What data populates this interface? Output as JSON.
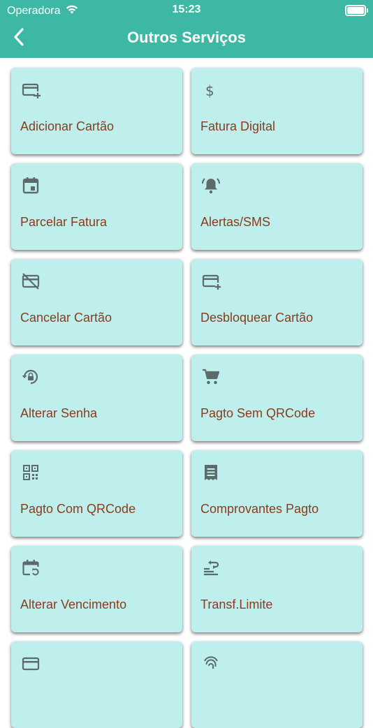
{
  "status_bar": {
    "carrier": "Operadora",
    "time": "15:23"
  },
  "nav": {
    "title": "Outros Serviços",
    "back_icon": "chevron-left-icon"
  },
  "colors": {
    "header": "#3cb8a5",
    "tile_background": "#bfefec",
    "tile_label": "#8a3b1c",
    "icon": "#5d6a6c"
  },
  "services": [
    {
      "label": "Adicionar Cartão",
      "icon": "card-plus-icon"
    },
    {
      "label": "Fatura Digital",
      "icon": "dollar-icon"
    },
    {
      "label": "Parcelar Fatura",
      "icon": "calendar-icon"
    },
    {
      "label": "Alertas/SMS",
      "icon": "bell-alert-icon"
    },
    {
      "label": "Cancelar Cartão",
      "icon": "card-off-icon"
    },
    {
      "label": "Desbloquear Cartão",
      "icon": "card-plus-icon"
    },
    {
      "label": "Alterar Senha",
      "icon": "lock-reset-icon"
    },
    {
      "label": "Pagto Sem QRCode",
      "icon": "cart-icon"
    },
    {
      "label": "Pagto Com QRCode",
      "icon": "qrcode-icon"
    },
    {
      "label": "Comprovantes Pagto",
      "icon": "receipt-icon"
    },
    {
      "label": "Alterar Vencimento",
      "icon": "calendar-refresh-icon"
    },
    {
      "label": "Transf.Limite",
      "icon": "transfer-icon"
    },
    {
      "label": "",
      "icon": "card-icon"
    },
    {
      "label": "",
      "icon": "fingerprint-icon"
    }
  ]
}
